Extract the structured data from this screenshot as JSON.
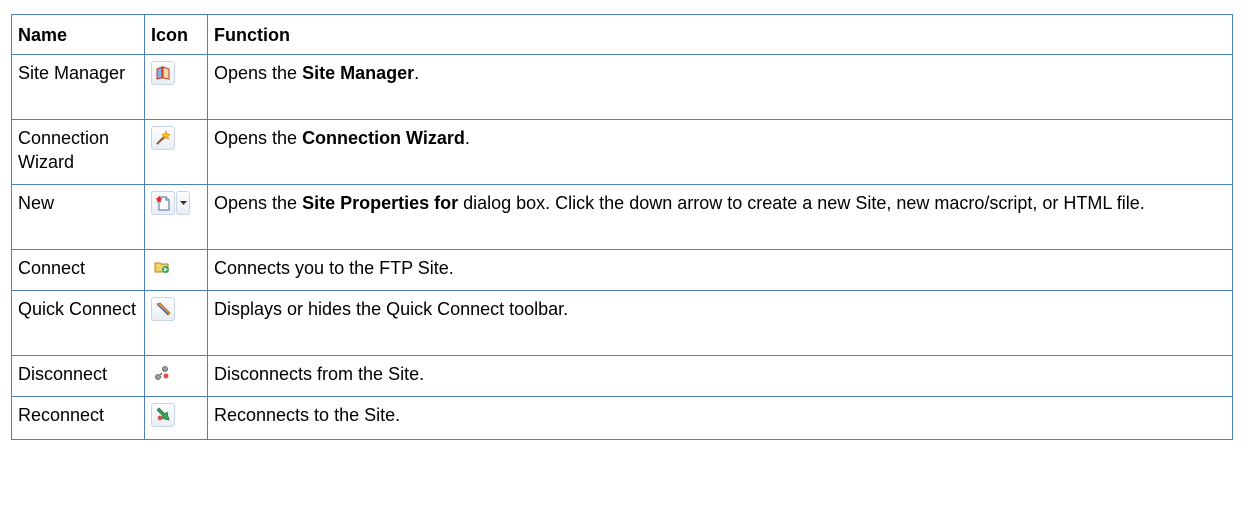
{
  "table": {
    "headers": {
      "name": "Name",
      "icon": "Icon",
      "function": "Function"
    },
    "rows": [
      {
        "name": "Site Manager",
        "icon": "site-manager-icon",
        "func_pre": "Opens the ",
        "func_bold": "Site Manager",
        "func_post": "."
      },
      {
        "name": "Connection Wizard",
        "icon": "connection-wizard-icon",
        "func_pre": "Opens the ",
        "func_bold": "Connection Wizard",
        "func_post": "."
      },
      {
        "name": "New",
        "icon": "new-document-icon",
        "func_pre": "Opens the ",
        "func_bold": "Site Properties for",
        "func_post": " dialog box. Click the down arrow to create a new Site, new macro/script, or HTML file."
      },
      {
        "name": "Connect",
        "icon": "connect-folder-icon",
        "func_pre": "Connects you to the FTP Site.",
        "func_bold": "",
        "func_post": ""
      },
      {
        "name": "Quick Connect",
        "icon": "quick-connect-icon",
        "func_pre": "Displays or hides the Quick Connect toolbar.",
        "func_bold": "",
        "func_post": ""
      },
      {
        "name": "Disconnect",
        "icon": "disconnect-icon",
        "func_pre": "Disconnects from the Site.",
        "func_bold": "",
        "func_post": ""
      },
      {
        "name": "Reconnect",
        "icon": "reconnect-icon",
        "func_pre": "Reconnects to the Site.",
        "func_bold": "",
        "func_post": ""
      }
    ]
  },
  "colors": {
    "border": "#4f81bd",
    "text": "#000000",
    "background": "#ffffff"
  }
}
